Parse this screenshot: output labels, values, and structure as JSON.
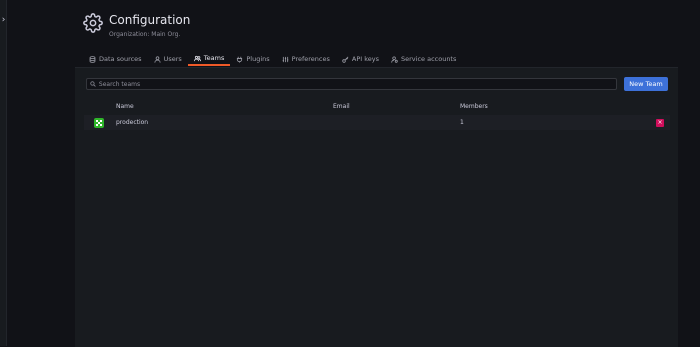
{
  "header": {
    "title": "Configuration",
    "subtitle": "Organization: Main Org.",
    "icon": "gear-icon"
  },
  "tabs": [
    {
      "label": "Data sources",
      "icon": "database-icon",
      "active": false
    },
    {
      "label": "Users",
      "icon": "user-icon",
      "active": false
    },
    {
      "label": "Teams",
      "icon": "users-icon",
      "active": true
    },
    {
      "label": "Plugins",
      "icon": "plug-icon",
      "active": false
    },
    {
      "label": "Preferences",
      "icon": "sliders-icon",
      "active": false
    },
    {
      "label": "API keys",
      "icon": "key-icon",
      "active": false
    },
    {
      "label": "Service accounts",
      "icon": "service-account-icon",
      "active": false
    }
  ],
  "search": {
    "placeholder": "Search teams",
    "value": ""
  },
  "new_team_label": "New Team",
  "table": {
    "columns": [
      "Name",
      "Email",
      "Members"
    ],
    "rows": [
      {
        "name": "prodection",
        "email": "",
        "members": "1",
        "avatar": "team-avatar-icon"
      }
    ]
  },
  "delete_label": "×",
  "colors": {
    "background": "#111217",
    "panel": "#181b1f",
    "accent_tab": "#f05a28",
    "primary_button": "#3d71d9",
    "delete_button": "#d10e5c",
    "avatar": "#2fb52a"
  }
}
